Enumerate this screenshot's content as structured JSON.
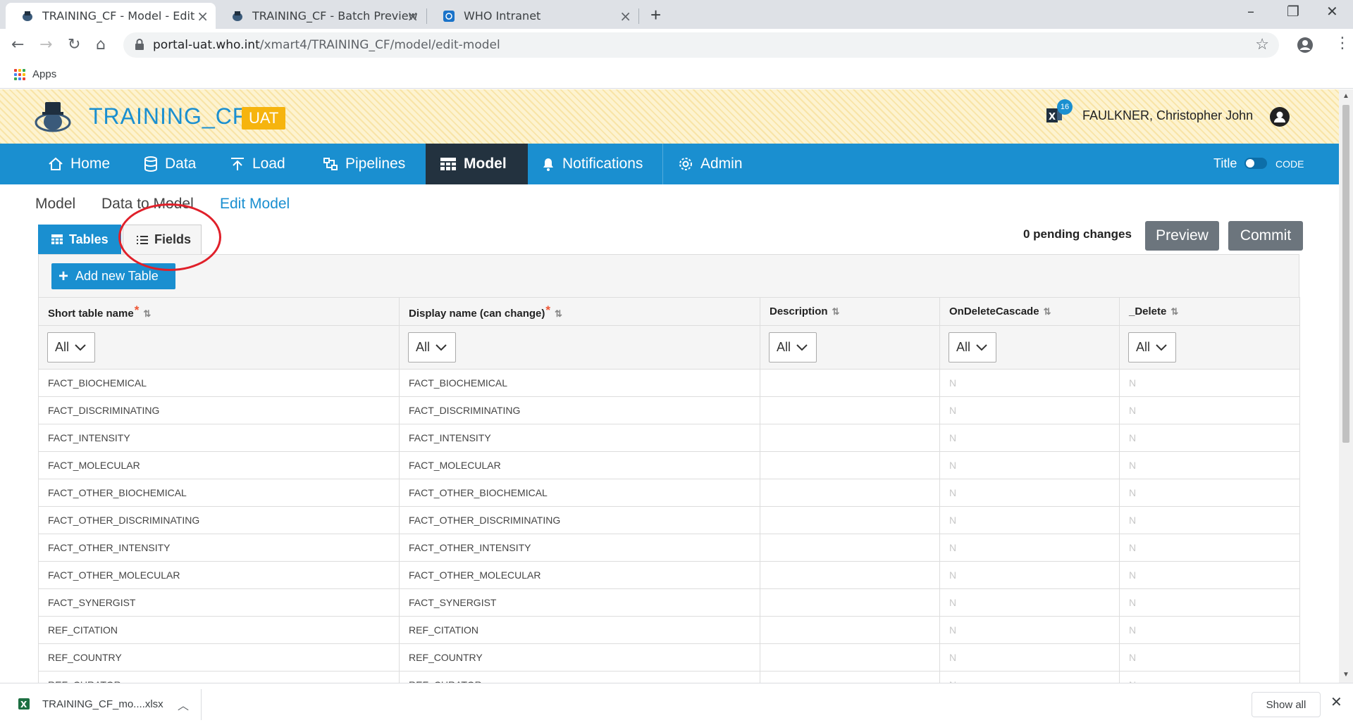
{
  "browser": {
    "tabs": [
      {
        "title": "TRAINING_CF - Model - Edit",
        "active": true
      },
      {
        "title": "TRAINING_CF - Batch Preview",
        "active": false
      },
      {
        "title": "WHO Intranet",
        "active": false
      }
    ],
    "url_host": "portal-uat.who.int",
    "url_path": "/xmart4/TRAINING_CF/model/edit-model",
    "bookmarks_apps": "Apps"
  },
  "header": {
    "brand": "TRAINING_CF",
    "env_badge": "UAT",
    "export_count": "16",
    "user_name": "FAULKNER, Christopher John"
  },
  "nav": {
    "items": [
      {
        "label": "Home",
        "icon": "home-icon"
      },
      {
        "label": "Data",
        "icon": "database-icon"
      },
      {
        "label": "Load",
        "icon": "upload-icon"
      },
      {
        "label": "Pipelines",
        "icon": "pipelines-icon"
      },
      {
        "label": "Model",
        "icon": "table-icon",
        "active": true
      },
      {
        "label": "Notifications",
        "icon": "bell-icon"
      },
      {
        "label": "Admin",
        "icon": "gear-icon"
      }
    ],
    "toggle_left": "Title",
    "toggle_right": "CODE"
  },
  "breadcrumb": [
    "Model",
    "Data to Model",
    "Edit Model"
  ],
  "subtabs": {
    "tables": "Tables",
    "fields": "Fields"
  },
  "actions": {
    "pending": "0 pending changes",
    "preview": "Preview",
    "commit": "Commit"
  },
  "toolbar": {
    "add_table": "Add new Table"
  },
  "grid": {
    "columns": [
      "Short table name",
      "Display name (can change)",
      "Description",
      "OnDeleteCascade",
      "_Delete"
    ],
    "required": [
      true,
      true,
      false,
      false,
      false
    ],
    "filter_value": "All",
    "rows": [
      [
        "FACT_BIOCHEMICAL",
        "FACT_BIOCHEMICAL",
        "",
        "N",
        "N"
      ],
      [
        "FACT_DISCRIMINATING",
        "FACT_DISCRIMINATING",
        "",
        "N",
        "N"
      ],
      [
        "FACT_INTENSITY",
        "FACT_INTENSITY",
        "",
        "N",
        "N"
      ],
      [
        "FACT_MOLECULAR",
        "FACT_MOLECULAR",
        "",
        "N",
        "N"
      ],
      [
        "FACT_OTHER_BIOCHEMICAL",
        "FACT_OTHER_BIOCHEMICAL",
        "",
        "N",
        "N"
      ],
      [
        "FACT_OTHER_DISCRIMINATING",
        "FACT_OTHER_DISCRIMINATING",
        "",
        "N",
        "N"
      ],
      [
        "FACT_OTHER_INTENSITY",
        "FACT_OTHER_INTENSITY",
        "",
        "N",
        "N"
      ],
      [
        "FACT_OTHER_MOLECULAR",
        "FACT_OTHER_MOLECULAR",
        "",
        "N",
        "N"
      ],
      [
        "FACT_SYNERGIST",
        "FACT_SYNERGIST",
        "",
        "N",
        "N"
      ],
      [
        "REF_CITATION",
        "REF_CITATION",
        "",
        "N",
        "N"
      ],
      [
        "REF_COUNTRY",
        "REF_COUNTRY",
        "",
        "N",
        "N"
      ],
      [
        "REF_CURATOR",
        "REF_CURATOR",
        "",
        "N",
        "N"
      ]
    ]
  },
  "download": {
    "file": "TRAINING_CF_mo....xlsx",
    "show_all": "Show all"
  },
  "colors": {
    "brand_blue": "#1a8fd0",
    "nav_active": "#23323f",
    "uat_badge": "#f6b40e",
    "annotation": "#e0202a"
  }
}
